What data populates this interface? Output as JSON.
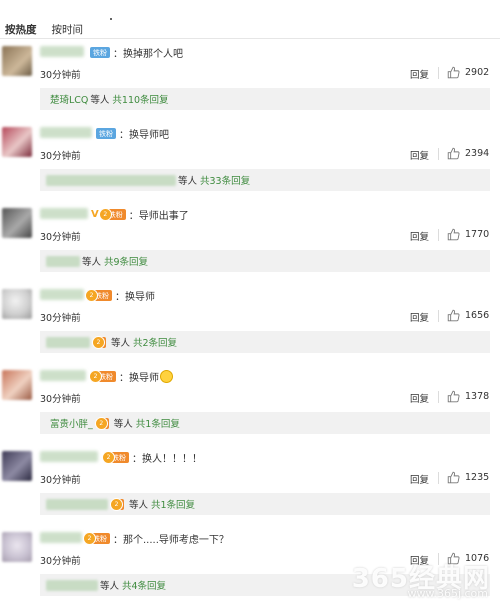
{
  "tabs": [
    {
      "label": "按热度",
      "active": true
    },
    {
      "label": "按时间",
      "active": false
    }
  ],
  "comments": [
    {
      "badge": "铁粉",
      "text": "：换掉那个人吧",
      "time": "30分钟前",
      "reply": "回复",
      "likes": "2902",
      "replybar": {
        "names": "楚琦LCQ",
        "deng": " 等人",
        "count": "共110条回复"
      }
    },
    {
      "badge": "铁粉",
      "text": "：换导师吧",
      "time": "30分钟前",
      "reply": "回复",
      "likes": "2394",
      "replybar": {
        "names": "",
        "deng": "等人",
        "count": "共33条回复"
      }
    },
    {
      "badge": "铁粉",
      "text": "：导师出事了",
      "time": "30分钟前",
      "reply": "回复",
      "likes": "1770",
      "replybar": {
        "names": "",
        "deng": "等人",
        "count": "共9条回复"
      }
    },
    {
      "badge": "铁粉",
      "text": "：换导师",
      "time": "30分钟前",
      "reply": "回复",
      "likes": "1656",
      "replybar": {
        "names": "",
        "deng": " 等人",
        "count": "共2条回复"
      }
    },
    {
      "badge": "铁粉",
      "text": "：换导师",
      "time": "30分钟前",
      "reply": "回复",
      "likes": "1378",
      "replybar": {
        "names": "富贵小胖_",
        "deng": " 等人",
        "count": "共1条回复"
      }
    },
    {
      "badge": "铁粉",
      "text": "：换人！！！！",
      "time": "30分钟前",
      "reply": "回复",
      "likes": "1235",
      "replybar": {
        "names": "",
        "deng": " 等人",
        "count": "共1条回复"
      }
    },
    {
      "badge": "铁粉",
      "text": "：那个.....导师考虑一下？",
      "time": "30分钟前",
      "reply": "回复",
      "likes": "1076",
      "replybar": {
        "names": "",
        "deng": "等人",
        "count": "共4条回复"
      }
    }
  ],
  "watermark": {
    "text": "365经典网",
    "url": "www.365j.com"
  },
  "colors": {
    "green": "#3e8b3e",
    "badge_blue": "#5ba6e0",
    "badge_orange": "#f08a2c",
    "replybar_bg": "#f1f1f1"
  }
}
